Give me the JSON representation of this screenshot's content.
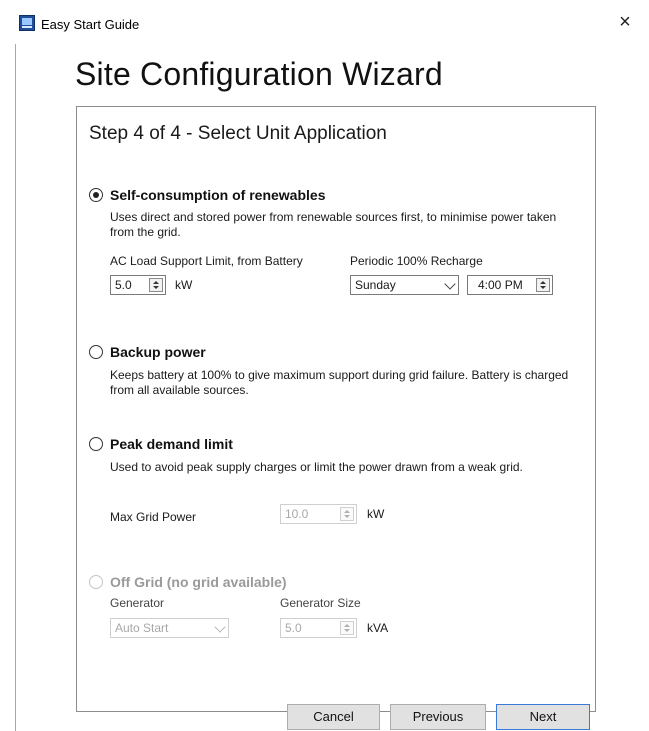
{
  "window": {
    "title": "Easy Start Guide",
    "close_glyph": "×"
  },
  "heading": "Site Configuration Wizard",
  "step_title": "Step 4 of 4 - Select Unit Application",
  "options": {
    "self_consumption": {
      "label": "Self-consumption of renewables",
      "selected": true,
      "description": "Uses direct and stored power from renewable sources first, to minimise power taken from the grid.",
      "ac_load_label": "AC Load Support Limit, from Battery",
      "ac_load_value": "5.0",
      "ac_load_unit": "kW",
      "recharge_label": "Periodic 100% Recharge",
      "recharge_day": "Sunday",
      "recharge_time": "4:00 PM"
    },
    "backup": {
      "label": "Backup power",
      "selected": false,
      "description": "Keeps battery at 100% to give maximum support during grid failure. Battery is charged from all available sources."
    },
    "peak": {
      "label": "Peak demand limit",
      "selected": false,
      "description": "Used to avoid peak supply charges or limit the power drawn from a weak grid.",
      "max_grid_label": "Max Grid Power",
      "max_grid_value": "10.0",
      "max_grid_unit": "kW"
    },
    "off_grid": {
      "label": "Off Grid (no grid available)",
      "enabled": false,
      "generator_label": "Generator",
      "generator_value": "Auto Start",
      "size_label": "Generator Size",
      "size_value": "5.0",
      "size_unit": "kVA"
    }
  },
  "buttons": {
    "cancel": "Cancel",
    "previous": "Previous",
    "next": "Next"
  },
  "icons": {
    "app": "app-window-icon",
    "close": "close-icon",
    "spin": "spinner-arrows-icon",
    "dropdown": "chevron-down-icon"
  },
  "colors": {
    "accent_border": "#3a7ad6",
    "button_face": "#e1e1e1",
    "disabled_text": "#a8a8a8"
  }
}
